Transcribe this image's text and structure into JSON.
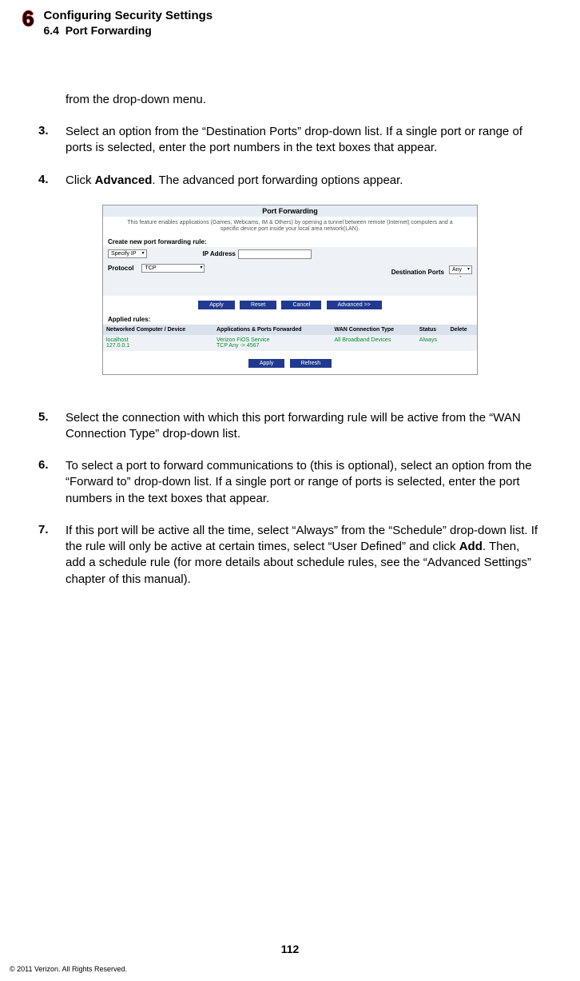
{
  "header": {
    "chapter_number": "6",
    "chapter_title": "Configuring Security Settings",
    "section_number": "6.4",
    "section_title": "Port Forwarding"
  },
  "fragment_line": "from the drop-down menu.",
  "steps_a": [
    {
      "num": "3.",
      "text": "Select an option from the “Destination Ports” drop-down list. If a single port or range of ports is selected, enter the port numbers in the text boxes that appear."
    },
    {
      "num": "4.",
      "text_pre": "Click ",
      "bold": "Advanced",
      "text_post": ".  The advanced port forwarding options appear."
    }
  ],
  "screenshot": {
    "title": "Port Forwarding",
    "desc": "This feature enables applications (Games, Webcams, IM & Others) by opening a tunnel between remote (Internet) computers and a specific device port inside your local area network(LAN).",
    "create_label": "Create new port forwarding rule:",
    "specify_ip": "Specify IP",
    "ip_address_label": "IP Address",
    "protocol_label": "Protocol",
    "protocol_value": "TCP",
    "dest_ports_label": "Destination Ports",
    "dest_ports_value": "Any",
    "dest_ports_dash": "-",
    "buttons_row1": [
      "Apply",
      "Reset",
      "Cancel",
      "Advanced >>"
    ],
    "applied_label": "Applied rules:",
    "table_headers": [
      "Networked Computer / Device",
      "Applications & Ports Forwarded",
      "WAN Connection Type",
      "Status",
      "Delete"
    ],
    "row": {
      "device_name": "localhost",
      "device_ip": "127.0.0.1",
      "apps_line1": "Verizon FiOS Service",
      "apps_line2": "TCP Any -> 4567",
      "wan": "All Broadband Devices",
      "status": "Always"
    },
    "buttons_row2": [
      "Apply",
      "Refresh"
    ]
  },
  "steps_b": [
    {
      "num": "5.",
      "text": "Select the connection with which this port forwarding rule will be active from the “WAN Connection Type” drop-down list."
    },
    {
      "num": "6.",
      "text": "To select a port to forward communications to (this is optional), select an option from the “Forward to” drop-down list. If a single port or range of ports is selected, enter the port numbers in the text boxes that appear."
    },
    {
      "num": "7.",
      "text_pre": "If this port will be active all the time, select “Always” from the “Schedule” drop-down list. If the rule will only be active at certain times, select “User Defined” and click ",
      "bold": "Add",
      "text_post": ". Then, add a schedule rule (for more details about schedule rules, see the “Advanced Settings” chapter of this manual)."
    }
  ],
  "page_number": "112",
  "copyright": "© 2011 Verizon. All Rights Reserved."
}
